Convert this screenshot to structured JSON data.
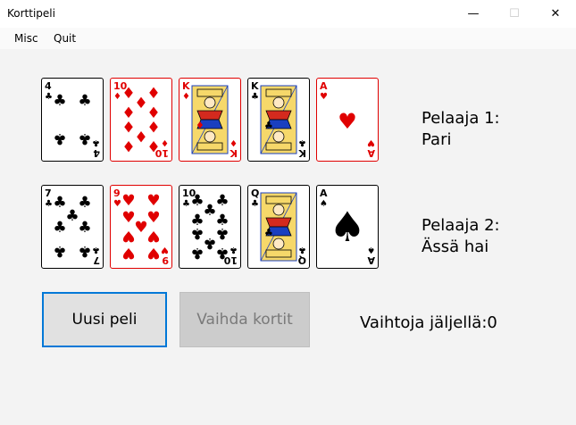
{
  "window": {
    "title": "Korttipeli"
  },
  "window_buttons": {
    "minimize": "—",
    "maximize": "☐",
    "close": "✕"
  },
  "menu": [
    {
      "label": "Misc"
    },
    {
      "label": "Quit"
    }
  ],
  "player1": {
    "label": "Pelaaja 1:",
    "hand": "Pari",
    "cards": [
      {
        "rank": "4",
        "suit": "clubs"
      },
      {
        "rank": "10",
        "suit": "diamonds"
      },
      {
        "rank": "K",
        "suit": "diamonds"
      },
      {
        "rank": "K",
        "suit": "clubs"
      },
      {
        "rank": "A",
        "suit": "hearts"
      }
    ]
  },
  "player2": {
    "label": "Pelaaja 2:",
    "hand": "Ässä hai",
    "cards": [
      {
        "rank": "7",
        "suit": "clubs"
      },
      {
        "rank": "9",
        "suit": "hearts"
      },
      {
        "rank": "10",
        "suit": "clubs"
      },
      {
        "rank": "Q",
        "suit": "clubs"
      },
      {
        "rank": "A",
        "suit": "spades"
      }
    ]
  },
  "buttons": {
    "new_game": "Uusi peli",
    "swap_cards": "Vaihda kortit"
  },
  "swaps_left": "Vaihtoja jäljellä:0",
  "colors": {
    "red": "#e00000",
    "black": "#000000",
    "accent": "#0078d7"
  }
}
